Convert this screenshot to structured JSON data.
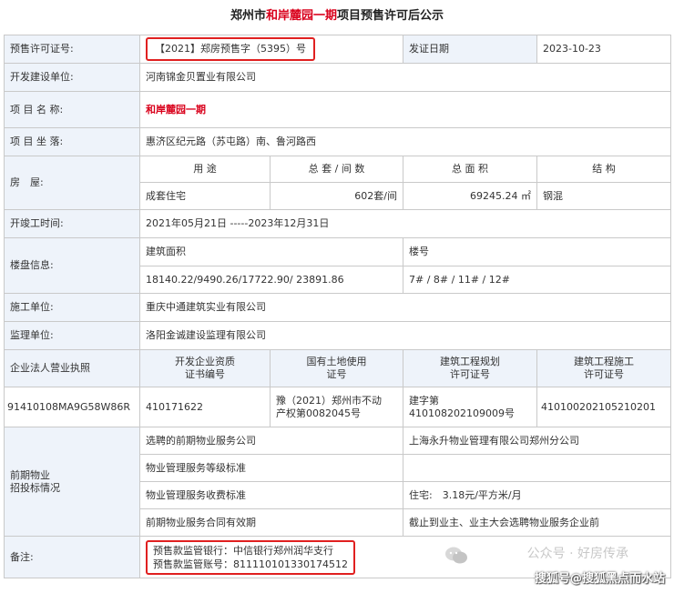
{
  "title": {
    "prefix": "郑州市",
    "highlight": "和岸麓园一期",
    "suffix": "项目预售许可后公示"
  },
  "rows": {
    "permit_label": "预售许可证号:",
    "permit_value": "【2021】郑房预售字（5395）号",
    "issue_label": "发证日期",
    "issue_value": "2023-10-23",
    "developer_label": "开发建设单位:",
    "developer_value": "河南锦金贝置业有限公司",
    "project_label": "项 目 名 称:",
    "project_value": "和岸麓园一期",
    "location_label": "项 目 坐 落:",
    "location_value": "惠济区纪元路（苏屯路）南、鲁河路西",
    "house_label": "房　屋:",
    "house_headers": [
      "用 途",
      "总 套 / 间 数",
      "总 面 积",
      "结 构"
    ],
    "house_values": [
      "成套住宅",
      "602套/间",
      "69245.24 ㎡",
      "钢混"
    ],
    "construction_label": "开竣工时间:",
    "construction_value": "2021年05月21日 -----2023年12月31日",
    "building_label": "楼盘信息:",
    "building_area_label": "建筑面积",
    "building_no_label": "楼号",
    "building_area_value": "18140.22/9490.26/17722.90/ 23891.86",
    "building_no_value": "7# / 8# / 11# / 12#",
    "contractor_label": "施工单位:",
    "contractor_value": "重庆中通建筑实业有限公司",
    "supervisor_label": "监理单位:",
    "supervisor_value": "洛阳金诚建设监理有限公司",
    "license_label": "企业法人营业执照",
    "license_headers": [
      "开发企业资质\n证书编号",
      "国有土地使用\n证号",
      "建筑工程规划\n许可证号",
      "建筑工程施工\n许可证号"
    ],
    "license_value": "91410108MA9G58W86R",
    "license_values": [
      "410171622",
      "豫（2021）郑州市不动\n产权第0082045号",
      "建字第\n410108202109009号",
      "410100202105210201"
    ],
    "property_label": "前期物业\n招投标情况",
    "property_items": [
      {
        "label": "选聘的前期物业服务公司",
        "value": "上海永升物业管理有限公司郑州分公司"
      },
      {
        "label": "物业管理服务等级标准",
        "value": ""
      },
      {
        "label": "物业管理服务收费标准",
        "value": "住宅:　3.18元/平方米/月"
      },
      {
        "label": "前期物业服务合同有效期",
        "value": "截止到业主、业主大会选聘物业服务企业前"
      }
    ],
    "remark_label": "备注:",
    "remark_line1": "预售款监管银行：中信银行郑州润华支行",
    "remark_line2": "预售款监管账号：811110101330174512"
  },
  "watermark": {
    "top": "公众号 · 好房传承",
    "bottom": "搜狐号@搜狐黑点而水站"
  },
  "colors": {
    "highlight": "#d9001b",
    "label_bg": "#eef3fa",
    "box": "#e02020"
  }
}
